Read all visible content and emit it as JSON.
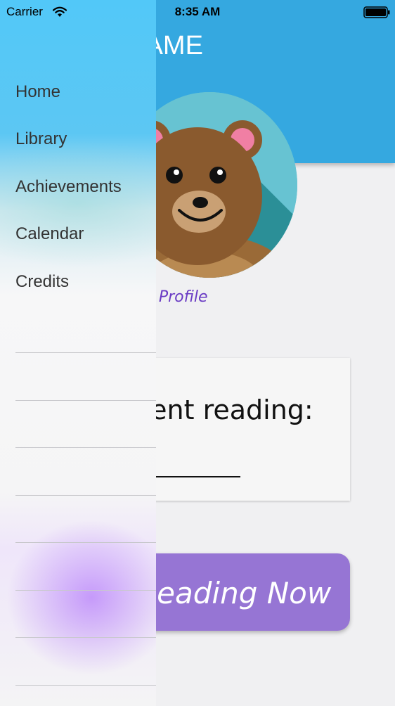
{
  "status_bar": {
    "carrier": "Carrier",
    "time": "8:35 AM"
  },
  "header": {
    "greeting": "llo, NAME"
  },
  "profile": {
    "change_label": "hange Profile"
  },
  "stats": {
    "label": "pent reading:"
  },
  "action": {
    "read_label": "Reading Now"
  },
  "drawer": {
    "items": [
      {
        "label": "Home"
      },
      {
        "label": "Library"
      },
      {
        "label": "Achievements"
      },
      {
        "label": "Calendar"
      },
      {
        "label": "Credits"
      }
    ]
  },
  "colors": {
    "header": "#35a8e0",
    "button": "#9675d4",
    "link": "#6a3bc4",
    "drawer_top": "#52c8f8"
  }
}
